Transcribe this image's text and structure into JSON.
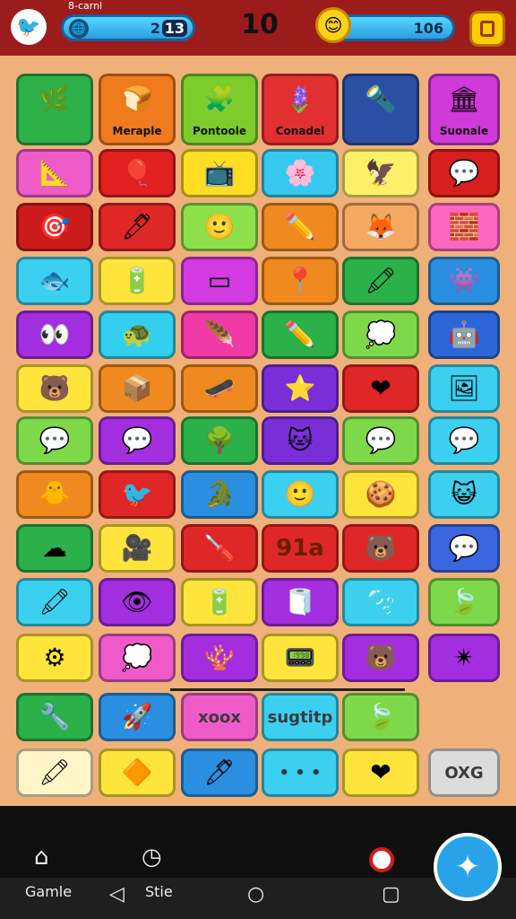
{
  "topbar": {
    "small_label": "8-carnl",
    "left_score": "2",
    "left_score_badge": "13",
    "level": "10",
    "right_score": "106"
  },
  "grid": [
    {
      "label": "",
      "glyph": "🌿",
      "color": "#2fb14a"
    },
    {
      "label": "Meraple",
      "glyph": "🍞",
      "color": "#f07a1e"
    },
    {
      "label": "Pontoole",
      "glyph": "🧩",
      "color": "#7ccc2c"
    },
    {
      "label": "Conadel",
      "glyph": "🪻",
      "color": "#e23030"
    },
    {
      "label": "",
      "glyph": "🔦",
      "color": "#2c4fa6"
    },
    {
      "label": "Suonale",
      "glyph": "🏛",
      "color": "#d03ad8"
    },
    {
      "label": "",
      "glyph": "📐",
      "color": "#ee5bc9"
    },
    {
      "label": "",
      "glyph": "🎈",
      "color": "#e22020"
    },
    {
      "label": "",
      "glyph": "📺",
      "color": "#ffdd22"
    },
    {
      "label": "",
      "glyph": "🌸",
      "color": "#37c8ef"
    },
    {
      "label": "",
      "glyph": "🦅",
      "color": "#fff06a"
    },
    {
      "label": "",
      "glyph": "💬",
      "color": "#d91e1e"
    },
    {
      "label": "",
      "glyph": "🎯",
      "color": "#cc1b1b"
    },
    {
      "label": "",
      "glyph": "🖊",
      "color": "#e02727"
    },
    {
      "label": "",
      "glyph": "🙂",
      "color": "#8ee04a"
    },
    {
      "label": "",
      "glyph": "✏️",
      "color": "#f08a20"
    },
    {
      "label": "",
      "glyph": "🦊",
      "color": "#f4a860"
    },
    {
      "label": "",
      "glyph": "🧱",
      "color": "#ff66c0"
    },
    {
      "label": "",
      "glyph": "🐟",
      "color": "#3bd0f0"
    },
    {
      "label": "",
      "glyph": "🔋",
      "color": "#ffe53b"
    },
    {
      "label": "",
      "glyph": "▭",
      "color": "#d33be0"
    },
    {
      "label": "",
      "glyph": "📍",
      "color": "#f08a20"
    },
    {
      "label": "",
      "glyph": "🖍",
      "color": "#2bb04a"
    },
    {
      "label": "",
      "glyph": "👾",
      "color": "#2a8fe0"
    },
    {
      "label": "",
      "glyph": "👀",
      "color": "#a32ee0"
    },
    {
      "label": "",
      "glyph": "🐢",
      "color": "#32cfef"
    },
    {
      "label": "",
      "glyph": "🪶",
      "color": "#ef3aa8"
    },
    {
      "label": "",
      "glyph": "✏️",
      "color": "#2bb04a"
    },
    {
      "label": "",
      "glyph": "💭",
      "color": "#7ed94a"
    },
    {
      "label": "",
      "glyph": "🤖",
      "color": "#2c66d8"
    },
    {
      "label": "",
      "glyph": "🐻",
      "color": "#ffe53b"
    },
    {
      "label": "",
      "glyph": "📦",
      "color": "#f08a20"
    },
    {
      "label": "",
      "glyph": "🛹",
      "color": "#f08a20"
    },
    {
      "label": "",
      "glyph": "⭐",
      "color": "#7a2ed8"
    },
    {
      "label": "",
      "glyph": "❤",
      "color": "#e02727"
    },
    {
      "label": "",
      "glyph": "🖼",
      "color": "#3bd0f0"
    },
    {
      "label": "",
      "glyph": "💬",
      "color": "#7ed94a"
    },
    {
      "label": "",
      "glyph": "💬",
      "color": "#a32ee0"
    },
    {
      "label": "",
      "glyph": "🌳",
      "color": "#2bb04a"
    },
    {
      "label": "",
      "glyph": "🐱",
      "color": "#7a2ed8"
    },
    {
      "label": "",
      "glyph": "💬",
      "color": "#7ed94a"
    },
    {
      "label": "",
      "glyph": "💬",
      "color": "#3bd0f0"
    },
    {
      "label": "",
      "glyph": "🐥",
      "color": "#f08a20"
    },
    {
      "label": "",
      "glyph": "🐦",
      "color": "#e02727"
    },
    {
      "label": "",
      "glyph": "🐊",
      "color": "#2a8fe0"
    },
    {
      "label": "",
      "glyph": "🙂",
      "color": "#3bd0f0"
    },
    {
      "label": "",
      "glyph": "🍪",
      "color": "#ffe53b"
    },
    {
      "label": "",
      "glyph": "😺",
      "color": "#3bd0f0"
    },
    {
      "label": "",
      "glyph": "☁",
      "color": "#2bb04a"
    },
    {
      "label": "",
      "glyph": "🎥",
      "color": "#ffe53b"
    },
    {
      "label": "",
      "glyph": "🪛",
      "color": "#e02727"
    },
    {
      "label": "",
      "glyph": "",
      "color": "#e02727",
      "text": "91a"
    },
    {
      "label": "",
      "glyph": "🐻",
      "color": "#e02727"
    },
    {
      "label": "",
      "glyph": "💬",
      "color": "#3a66e0"
    },
    {
      "label": "",
      "glyph": "🖍",
      "color": "#3bd0f0"
    },
    {
      "label": "",
      "glyph": "👁",
      "color": "#a32ee0"
    },
    {
      "label": "",
      "glyph": "🔋",
      "color": "#ffe53b"
    },
    {
      "label": "",
      "glyph": "🧻",
      "color": "#a32ee0"
    },
    {
      "label": "",
      "glyph": "🫧",
      "color": "#3bd0f0"
    },
    {
      "label": "",
      "glyph": "🍃",
      "color": "#7ed94a"
    },
    {
      "label": "",
      "glyph": "⚙",
      "color": "#ffe53b"
    },
    {
      "label": "",
      "glyph": "💭",
      "color": "#ee5bc9"
    },
    {
      "label": "",
      "glyph": "🪸",
      "color": "#a32ee0"
    },
    {
      "label": "",
      "glyph": "📟",
      "color": "#ffe53b"
    },
    {
      "label": "",
      "glyph": "🐻",
      "color": "#a32ee0"
    },
    {
      "label": "",
      "glyph": "✴",
      "color": "#a32ee0"
    },
    {
      "label": "",
      "glyph": "🔧",
      "color": "#2bb04a"
    },
    {
      "label": "",
      "glyph": "🚀",
      "color": "#2a8fe0"
    },
    {
      "label": "",
      "glyph": "",
      "color": "#ee5bc9",
      "text": "xoox"
    },
    {
      "label": "",
      "glyph": "",
      "color": "#3bd0f0",
      "text": "sugtitp"
    },
    {
      "label": "",
      "glyph": "🍃",
      "color": "#7ed94a"
    },
    {
      "label": "",
      "glyph": "",
      "color": "transparent"
    },
    {
      "label": "",
      "glyph": "🖍",
      "color": "#fff5c8"
    },
    {
      "label": "",
      "glyph": "🔶",
      "color": "#ffe53b"
    },
    {
      "label": "",
      "glyph": "🖊",
      "color": "#2a8fe0"
    },
    {
      "label": "",
      "glyph": "",
      "color": "#3bd0f0",
      "text": "• • •"
    },
    {
      "label": "",
      "glyph": "❤",
      "color": "#ffe53b"
    },
    {
      "label": "",
      "glyph": "",
      "color": "#dcdcdc",
      "text": "OXG"
    }
  ],
  "bottom_nav": {
    "game_label": "Gamle",
    "stats_label": "Stie"
  }
}
